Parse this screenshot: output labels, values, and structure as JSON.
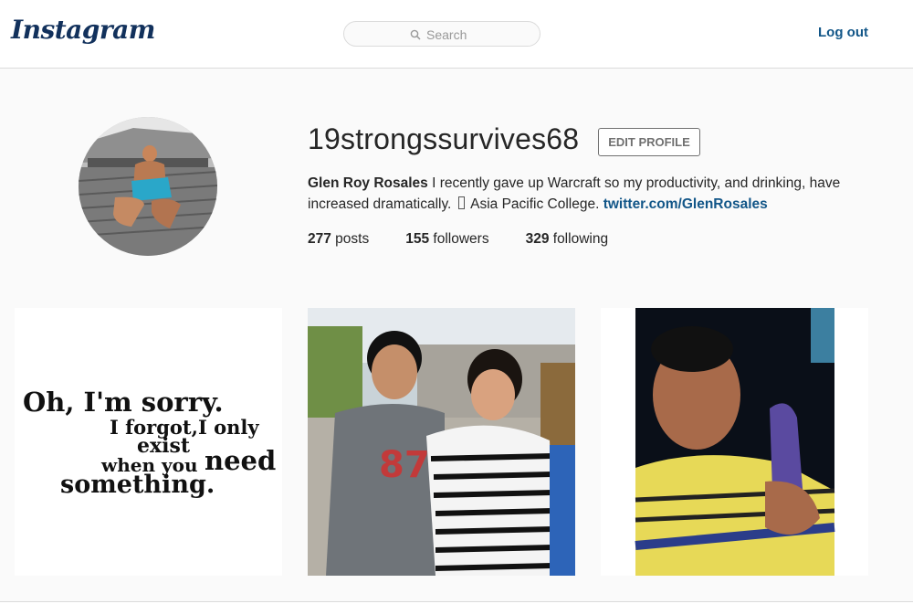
{
  "header": {
    "logo": "Instagram",
    "search_placeholder": "Search",
    "logout_label": "Log out"
  },
  "profile": {
    "username": "19strongssurvives68",
    "edit_profile_label": "EDIT PROFILE",
    "full_name": "Glen Roy Rosales",
    "bio_text": " I recently gave up Warcraft so my productivity, and drinking, have increased dramatically. ",
    "bio_school": " Asia Pacific College. ",
    "website": "twitter.com/GlenRosales",
    "stats": {
      "posts_count": "277",
      "posts_label": " posts",
      "followers_count": "155",
      "followers_label": " followers",
      "following_count": "329",
      "following_label": " following"
    }
  },
  "posts": [
    {
      "type": "text-image",
      "lines": [
        "Oh, I'm sorry.",
        "I forgot,I only",
        "exist",
        "when you",
        "need",
        "something."
      ]
    },
    {
      "type": "photo",
      "subject": "two-people-photo"
    },
    {
      "type": "photo",
      "subject": "selfie-inked-finger-photo"
    }
  ],
  "colors": {
    "link": "#125688",
    "logo": "#12315c",
    "border": "#dbdbdb",
    "background": "#fafafa"
  }
}
